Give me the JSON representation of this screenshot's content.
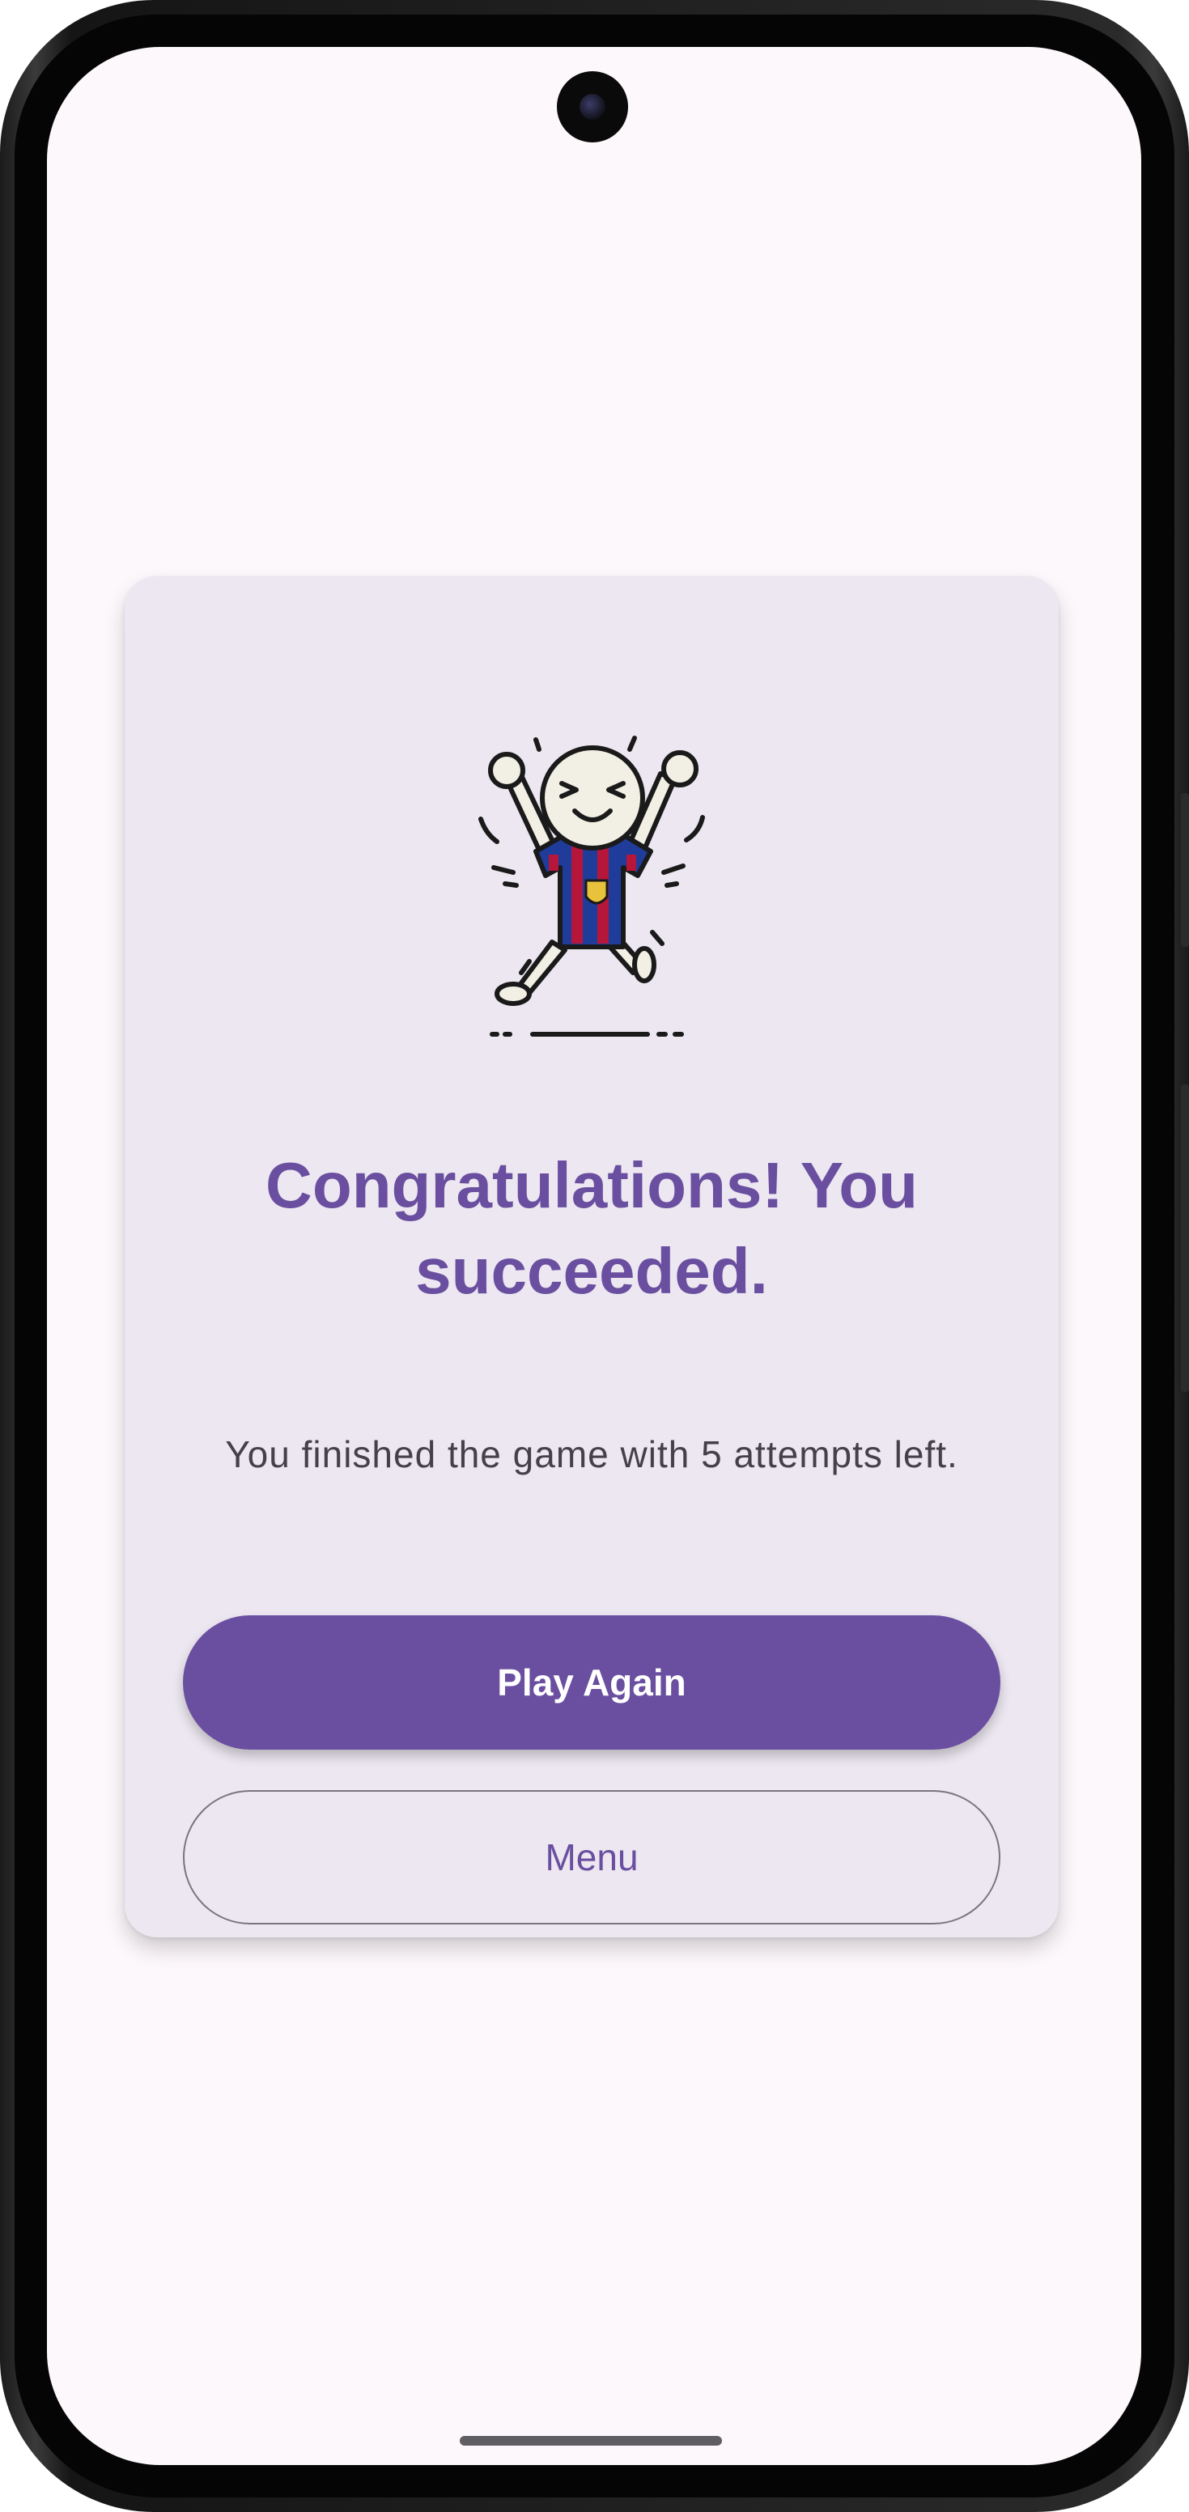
{
  "result": {
    "title": "Congratulations! You succeeded.",
    "message": "You finished the game with 5 attempts left."
  },
  "actions": {
    "play_again_label": "Play Again",
    "menu_label": "Menu"
  },
  "illustration": {
    "icon": "celebrating-character-icon",
    "description_colors": {
      "jersey_blue": "#1f3c9a",
      "jersey_red": "#b5163a"
    }
  },
  "theme": {
    "accent": "#6a4fa0",
    "card_background": "#ece7f0",
    "screen_background": "#fdf8fc"
  }
}
